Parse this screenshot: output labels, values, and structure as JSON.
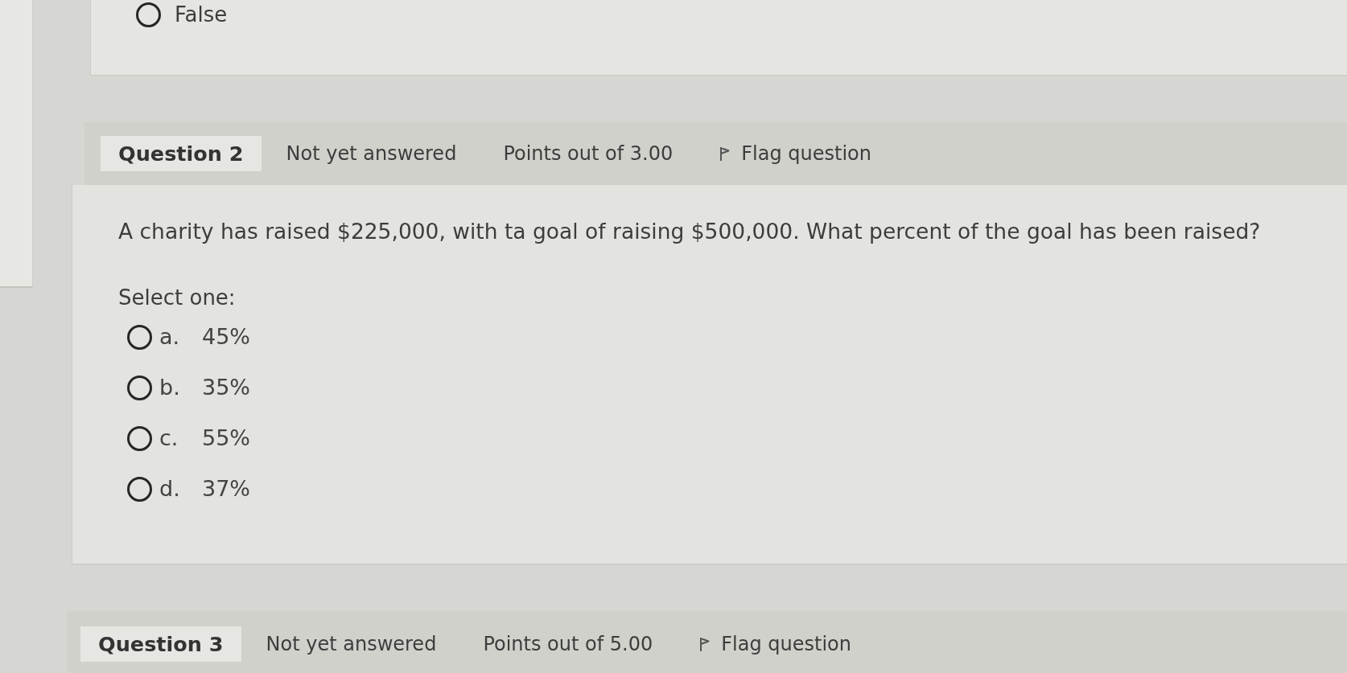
{
  "previous_question": {
    "options": [
      {
        "label": "False",
        "selected": false
      }
    ]
  },
  "questions": [
    {
      "number": "Question 2",
      "status": "Not yet answered",
      "points": "Points out of 3.00",
      "flag": "Flag question",
      "text": "A charity has raised $225,000, with ta goal of raising $500,000. What percent of the goal has been raised?",
      "prompt": "Select one:",
      "options": [
        {
          "letter": "a.",
          "answer": "45%",
          "selected": false
        },
        {
          "letter": "b.",
          "answer": "35%",
          "selected": false
        },
        {
          "letter": "c.",
          "answer": "55%",
          "selected": false
        },
        {
          "letter": "d.",
          "answer": "37%",
          "selected": false
        }
      ]
    },
    {
      "number": "Question 3",
      "status": "Not yet answered",
      "points": "Points out of 5.00",
      "flag": "Flag question"
    }
  ]
}
